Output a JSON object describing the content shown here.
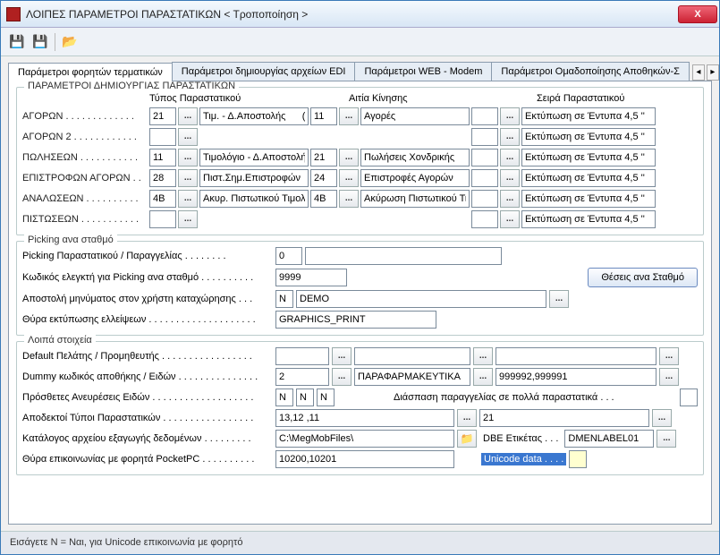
{
  "window": {
    "title": "ΛΟΙΠΕΣ ΠΑΡΑΜΕΤΡΟΙ ΠΑΡΑΣΤΑΤΙΚΩΝ < Τροποποίηση >"
  },
  "tabs": {
    "t1": "Παράμετροι φορητών τερματικών",
    "t2": "Παράμετροι δημιουργίας αρχείων EDI",
    "t3": "Παράμετροι WEB - Modem",
    "t4": "Παράμετροι Ομαδοποίησης Αποθηκών-Σ",
    "navLeft": "◂",
    "navRight": "▸"
  },
  "group1": {
    "title": "ΠΑΡΑΜΕΤΡΟΙ ΔΗΜΙΟΥΡΓΙΑΣ ΠΑΡΑΣΤΑΤΙΚΩΝ",
    "colType": "Τύπος Παραστατικού",
    "colReason": "Αιτία Κίνησης",
    "colSeries": "Σειρά Παραστατικού",
    "rows": [
      {
        "label": "ΑΓΟΡΩΝ . . . . . . . . . . . . .",
        "typeCode": "21",
        "typeDesc": "Τιμ. - Δ.Αποστολής      (Αγ",
        "reasonCode": "11",
        "reasonDesc": "Αγορές",
        "seriesDesc": "Εκτύπωση σε Έντυπα 4,5 ''"
      },
      {
        "label": "ΑΓΟΡΩΝ 2 . . . . . . . . . . . .",
        "typeCode": "",
        "typeDesc": "",
        "reasonCode": "",
        "reasonDesc": "",
        "seriesDesc": "Εκτύπωση σε Έντυπα 4,5 ''"
      },
      {
        "label": "ΠΩΛΗΣΕΩΝ . . . . . . . . . . .",
        "typeCode": "11",
        "typeDesc": "Τιμολόγιο - Δ.Αποστολής",
        "reasonCode": "21",
        "reasonDesc": "Πωλήσεις Χονδρικής",
        "seriesDesc": "Εκτύπωση σε Έντυπα 4,5 ''"
      },
      {
        "label": "ΕΠΙΣΤΡΟΦΩΝ ΑΓΟΡΩΝ . .",
        "typeCode": "28",
        "typeDesc": "Πιστ.Σημ.Επιστροφών  (Αγ",
        "reasonCode": "24",
        "reasonDesc": "Επιστροφές Αγορών",
        "seriesDesc": "Εκτύπωση σε Έντυπα 4,5 ''"
      },
      {
        "label": "ΑΝΑΛΩΣΕΩΝ . . . . . . . . . .",
        "typeCode": "4B",
        "typeDesc": "Ακυρ. Πιστωτικού Τιμολογί",
        "reasonCode": "4B",
        "reasonDesc": "Ακύρωση Πιστωτικού Τιμολ",
        "seriesDesc": "Εκτύπωση σε Έντυπα 4,5 ''"
      },
      {
        "label": "ΠΙΣΤΩΣΕΩΝ . . . . . . . . . . .",
        "typeCode": "",
        "typeDesc": "",
        "reasonCode": "",
        "reasonDesc": "",
        "seriesDesc": "Εκτύπωση σε Έντυπα 4,5 ''"
      }
    ]
  },
  "group2": {
    "title": "Picking ανα σταθμό",
    "r1l": "Picking Παραστατικού / Παραγγελίας . . . . . . . .",
    "r1v": "0",
    "r2l": "Κωδικός ελεγκτή για Picking ανα σταθμό . . . . . . . . . .",
    "r2v": "9999",
    "btnStations": "Θέσεις ανα Σταθμό",
    "r3l": "Αποστολή μηνύματος στον χρήστη καταχώρησης . . .",
    "r3v": "N",
    "r3d": "DEMO",
    "r4l": "Θύρα εκτύπωσης ελλείψεων . . . . . . . . . . . . . . . . . . . .",
    "r4v": "GRAPHICS_PRINT"
  },
  "group3": {
    "title": "Λοιπά στοιχεία",
    "r1l": "Default Πελάτης / Προμηθευτής . . . . . . . . . . . . . . . . .",
    "r2l": "Dummy κωδικός αποθήκης / Ειδών . . . . . . . . . . . . . . .",
    "r2v": "2",
    "r2d": "ΠΑΡΑΦΑΡΜΑΚΕΥΤΙΚΑ",
    "r2s": "999992,999991",
    "r3l": "Πρόσθετες Ανευρέσεις Ειδών . . . . . . . . . . . . . . . . . . .",
    "r3a": "N",
    "r3b": "N",
    "r3c": "N",
    "r3right": "Διάσπαση παραγγελίας σε πολλά παραστατικά . . .",
    "r4l": "Αποδεκτοί Τύποι Παραστατικών . . . . . . . . . . . . . . . . .",
    "r4a": "13,12 ,11",
    "r4b": "21",
    "r5l": "Κατάλογος αρχείου εξαγωγής δεδομένων . . . . . . . . .",
    "r5v": "C:\\MegMobFiles\\",
    "r5rl": "DBE Ετικέτας . . .",
    "r5rv": "DMENLABEL01",
    "r6l": "Θύρα επικοινωνίας με φορητά PocketPC . . . . . . . . . .",
    "r6v": "10200,10201",
    "r6rl": "Unicode data . . . .",
    "r6rv": ""
  },
  "status": "Εισάγετε Ν = Ναι, για Unicode επικοινωνία με φορητό",
  "icons": {
    "ellipsis": "...",
    "close": "X",
    "save": "💾",
    "saveas": "💾",
    "open": "📂",
    "folder": "📁"
  }
}
